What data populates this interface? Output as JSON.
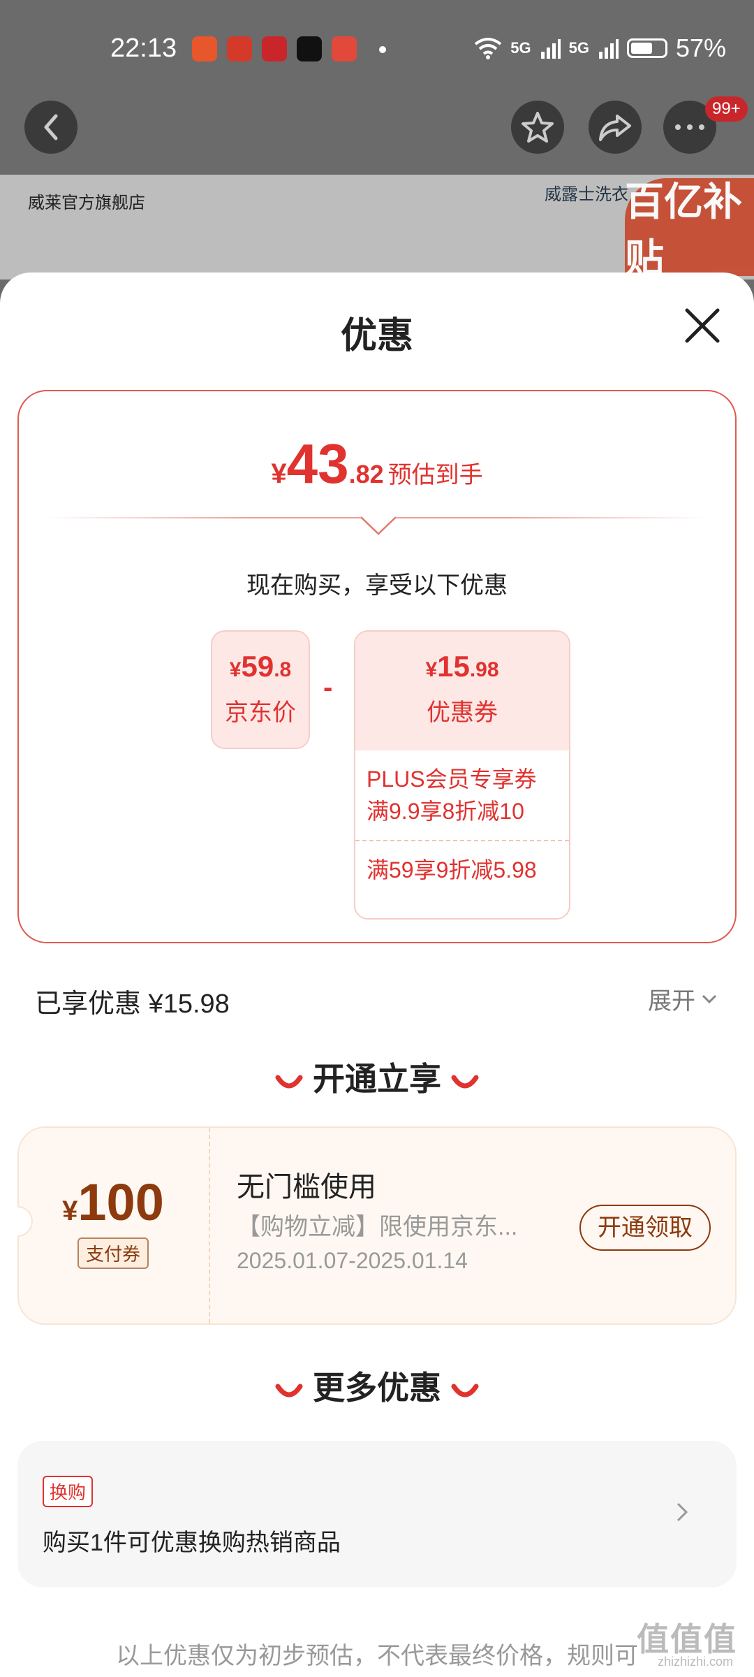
{
  "status": {
    "time": "22:13",
    "battery": "57%",
    "signal1": "5G",
    "signal2": "5G"
  },
  "header": {
    "cart_badge": "99+"
  },
  "background": {
    "store_name": "威莱官方旗舰店",
    "second_store": "威露士洗衣",
    "promo": "百亿补贴"
  },
  "sheet": {
    "title": "优惠"
  },
  "estimate": {
    "symbol": "¥",
    "integer": "43",
    "decimal": ".82",
    "label": "预估到手"
  },
  "buy_now_text": "现在购买，享受以下优惠",
  "jd_price": {
    "symbol": "¥",
    "integer": "59",
    "decimal": ".8",
    "label": "京东价"
  },
  "minus": "-",
  "coupon": {
    "symbol": "¥",
    "integer": "15",
    "decimal": ".98",
    "label": "优惠券",
    "items": [
      "PLUS会员专享券 满9.9享8折减10",
      "满59享9折减5.98"
    ]
  },
  "enjoyed": "已享优惠 ¥15.98",
  "expand": "展开",
  "section_open": "开通立享",
  "pay_coupon": {
    "symbol": "¥",
    "amount": "100",
    "tag": "支付券",
    "title": "无门槛使用",
    "desc": "【购物立减】限使用京东...",
    "date": "2025.01.07-2025.01.14",
    "button": "开通领取"
  },
  "section_more": "更多优惠",
  "more": {
    "tag": "换购",
    "text": "购买1件可优惠换购热销商品"
  },
  "footnote": "以上优惠仅为初步预估，不代表最终价格，规则可",
  "watermark": "值值值",
  "watermark_sub": "zhizhizhi.com",
  "colors": {
    "accent": "#e0322f",
    "brown": "#8c3a0e"
  }
}
